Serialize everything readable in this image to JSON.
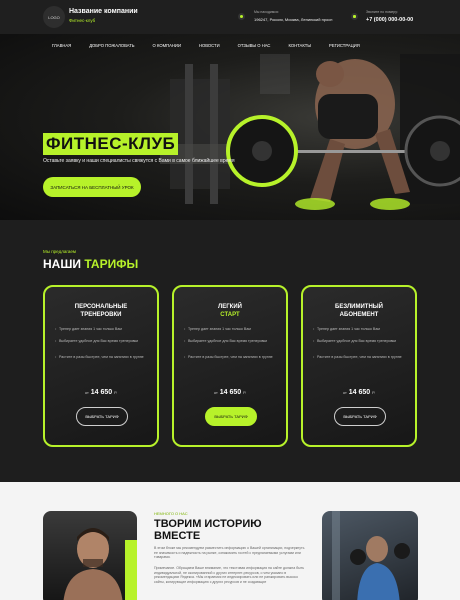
{
  "header": {
    "logo": "LOGO",
    "company_name": "Название компании",
    "company_sub": "Фитнес-клуб",
    "address_caption": "Мы находимся:",
    "address": "196247, Россия, Москва, Ленинский просп",
    "phone_caption": "Звоните по номеру:",
    "phone": "+7 (000) 000-00-00"
  },
  "nav": [
    "ГЛАВНАЯ",
    "ДОБРО ПОЖАЛОВАТЬ",
    "О КОМПАНИИ",
    "НОВОСТИ",
    "ОТЗЫВЫ О НАС",
    "КОНТАКТЫ",
    "РЕГИСТРАЦИЯ"
  ],
  "hero": {
    "title": "ФИТНЕС-КЛУБ",
    "description": "Оставьте заявку и наши специалисты свяжутся с Вами в самое ближайшее время",
    "cta": "ЗАПИСАТЬСЯ НА БЕСПЛАТНЫЙ УРОК"
  },
  "tariffs": {
    "overline": "Мы предлагаем",
    "title_white": "НАШИ ",
    "title_accent": "ТАРИФЫ",
    "cards": [
      {
        "name1": "ПЕРСОНАЛЬНЫЕ",
        "name2": "ТРЕНЕРОВКИ",
        "features": [
          "Тренер дает знания 1 час только Вам",
          "Выбираете удобное для Вас время тренеровки",
          "Растите в разы быстрее, чем на занятиях в группе"
        ],
        "from": "от",
        "price": "14 650",
        "currency": "Р.",
        "button": "ВЫБРАТЬ ТАРИФ"
      },
      {
        "name1": "ЛЕГКИЙ",
        "name2": "СТАРТ",
        "features": [
          "Тренер дает знания 1 час только Вам",
          "Выбираете удобное для Вас время тренеровки",
          "Растите в разы быстрее, чем на занятиях в группе"
        ],
        "from": "от",
        "price": "14 650",
        "currency": "Р.",
        "button": "ВЫБРАТЬ ТАРИФ"
      },
      {
        "name1": "БЕЗЛИМИТНЫЙ",
        "name2": "АБОНЕМЕНТ",
        "features": [
          "Тренер дает знания 1 час только Вам",
          "Выбираете удобное для Вас время тренеровки",
          "Растите в разы быстрее, чем на занятиях в группе"
        ],
        "from": "от",
        "price": "14 650",
        "currency": "Р.",
        "button": "ВЫБРАТЬ ТАРИФ"
      }
    ]
  },
  "about": {
    "overline": "НЕМНОГО О НАС",
    "title1": "ТВОРИМ ИСТОРИЮ",
    "title2": "ВМЕСТЕ",
    "p1": "В этом блоке мы рекомендуем разместить информацию о Вашей организации, подчеркнуть ее значимость и надежность на рынке, ознакомить гостей с предлагаемыми услугами или товарами.",
    "p2": "Примечание. Обращаем Ваше внимание, что текстовая информация на сайте должна быть индивидуальной, не скопированной с других интернет-ресурсов, о чем указано в рекомендациях Яндекса. «Мы стараемся не индексировать или не ранжировать высоко сайты, копирующие информацию с других ресурсов и не создающие"
  }
}
